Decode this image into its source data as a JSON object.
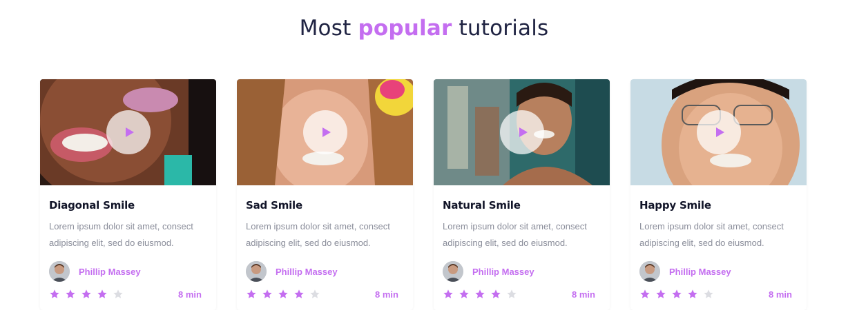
{
  "header": {
    "title_before": "Most",
    "title_highlight": "popular",
    "title_after": "tutorials"
  },
  "colors": {
    "accent": "#c46ef0",
    "star_on": "#c46ef0",
    "star_off": "#dcdde2",
    "heading": "#1f2342",
    "muted": "#8a8d9a"
  },
  "tutorials": [
    {
      "title": "Diagonal Smile",
      "description": "Lorem ipsum dolor sit amet, consect adipiscing elit, sed do eiusmod.",
      "author": "Phillip Massey",
      "rating": 4,
      "max_rating": 5,
      "duration": "8 min",
      "icon": "play-icon"
    },
    {
      "title": "Sad Smile",
      "description": "Lorem ipsum dolor sit amet, consect adipiscing elit, sed do eiusmod.",
      "author": "Phillip Massey",
      "rating": 4,
      "max_rating": 5,
      "duration": "8 min",
      "icon": "play-icon"
    },
    {
      "title": "Natural Smile",
      "description": "Lorem ipsum dolor sit amet, consect adipiscing elit, sed do eiusmod.",
      "author": "Phillip Massey",
      "rating": 4,
      "max_rating": 5,
      "duration": "8 min",
      "icon": "play-icon"
    },
    {
      "title": "Happy Smile",
      "description": "Lorem ipsum dolor sit amet, consect adipiscing elit, sed do eiusmod.",
      "author": "Phillip Massey",
      "rating": 4,
      "max_rating": 5,
      "duration": "8 min",
      "icon": "play-icon"
    }
  ]
}
